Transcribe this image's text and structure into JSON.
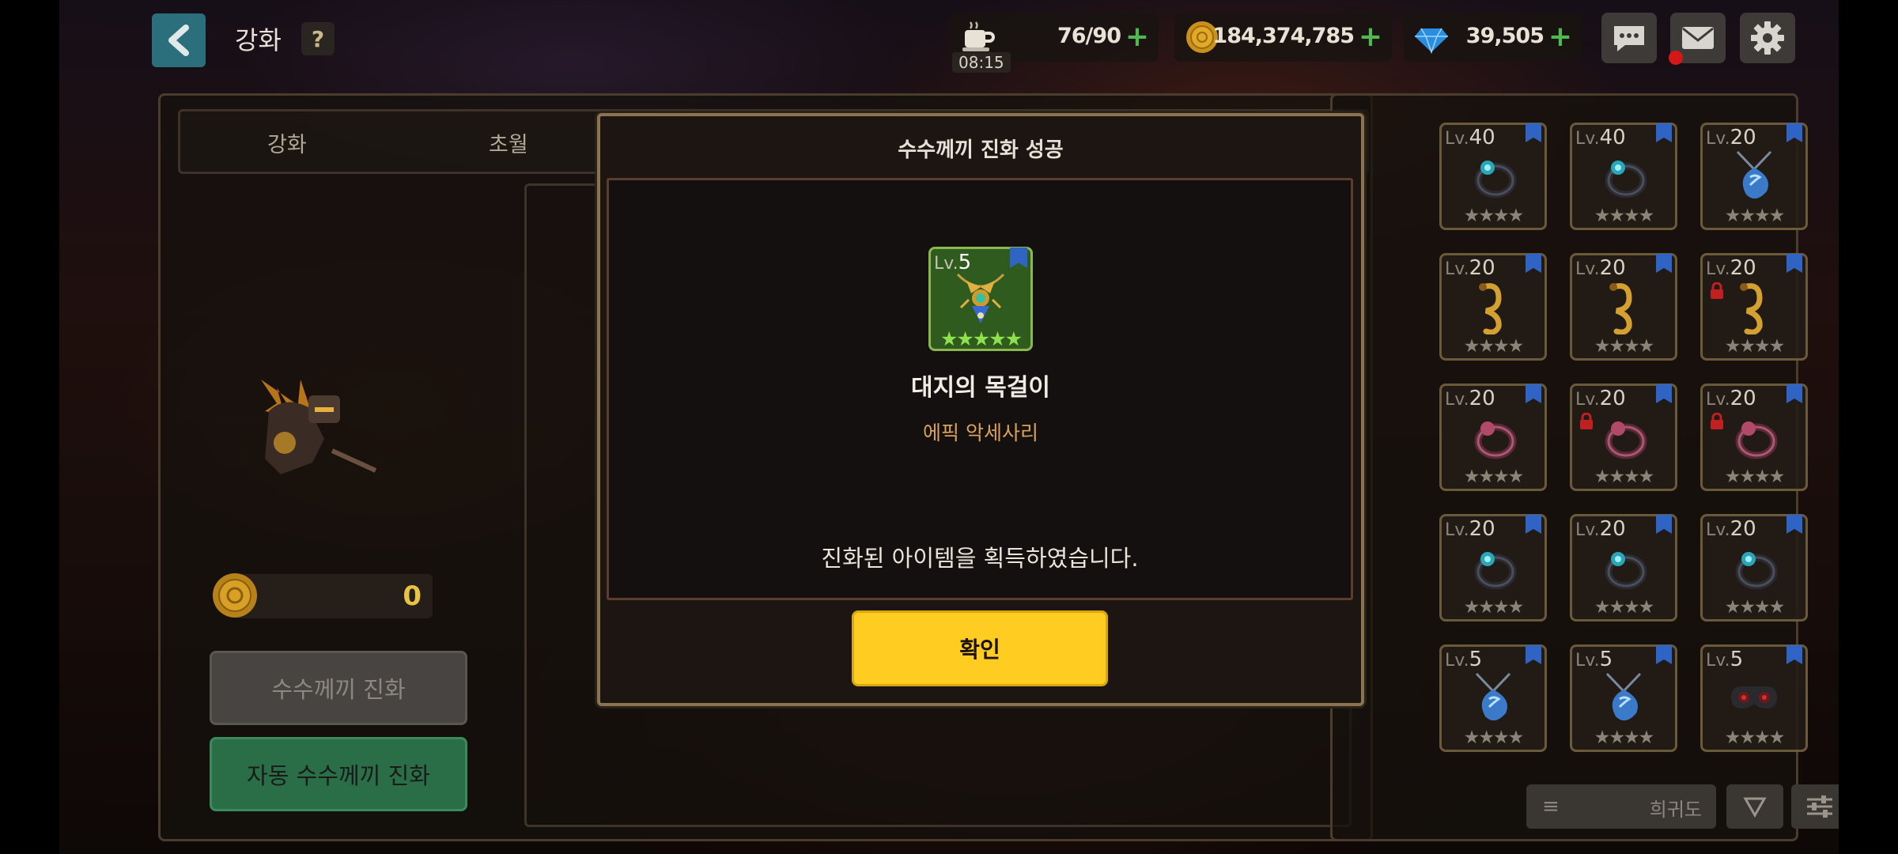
{
  "header": {
    "title": "강화",
    "help_label": "?",
    "stamina": {
      "value": "76/90",
      "timer": "08:15"
    },
    "gold": {
      "value": "184,374,785"
    },
    "gems": {
      "value": "39,505"
    },
    "plus_label": "+"
  },
  "tabs": [
    {
      "label": "강화"
    },
    {
      "label": "초월"
    }
  ],
  "left_panel": {
    "coin_amount": "0",
    "evolve_button": "수수께끼 진화",
    "auto_evolve_button": "자동 수수께끼 진화"
  },
  "dialog": {
    "title": "수수께끼 진화 성공",
    "item": {
      "level_prefix": "Lv.",
      "level": "5",
      "stars": "★★★★★",
      "name": "대지의 목걸이",
      "grade": "에픽 악세사리"
    },
    "message": "진화된 아이템을 획득하였습니다.",
    "confirm_button": "확인"
  },
  "inventory": {
    "level_prefix": "Lv.",
    "stars": "★★★★",
    "items": [
      {
        "level": "40",
        "icon": "ring-icon",
        "locked": false
      },
      {
        "level": "40",
        "icon": "ring-icon",
        "locked": false
      },
      {
        "level": "20",
        "icon": "necklace-icon",
        "locked": false
      },
      {
        "level": "20",
        "icon": "earring-icon",
        "locked": false
      },
      {
        "level": "20",
        "icon": "earring-icon",
        "locked": false
      },
      {
        "level": "20",
        "icon": "earring-icon",
        "locked": true
      },
      {
        "level": "20",
        "icon": "ring-icon",
        "locked": false
      },
      {
        "level": "20",
        "icon": "ring-icon",
        "locked": true
      },
      {
        "level": "20",
        "icon": "ring-icon",
        "locked": true
      },
      {
        "level": "20",
        "icon": "ring-icon",
        "locked": false
      },
      {
        "level": "20",
        "icon": "ring-icon",
        "locked": false
      },
      {
        "level": "20",
        "icon": "ring-icon",
        "locked": false
      },
      {
        "level": "5",
        "icon": "necklace-icon",
        "locked": false
      },
      {
        "level": "5",
        "icon": "necklace-icon",
        "locked": false
      },
      {
        "level": "5",
        "icon": "goggles-icon",
        "locked": false
      }
    ],
    "sort_label": "희귀도"
  },
  "colors": {
    "accent_yellow": "#ffcc22",
    "green_button": "#2a6e48",
    "back_button": "#2b6e7c",
    "gold_text": "#e8c244",
    "epic_grade": "#d9a25c"
  }
}
